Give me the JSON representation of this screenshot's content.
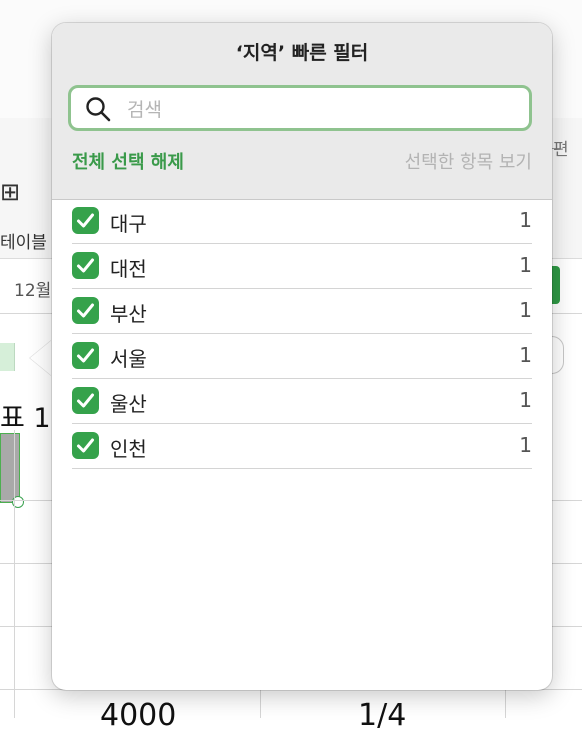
{
  "background": {
    "toolbar_label_left": "테이블",
    "size_label_left": "12월",
    "table_title": "표 1",
    "right_edge_text": "편",
    "cell_values": [
      "4000",
      "1/4"
    ]
  },
  "popover": {
    "title": "‘지역’ 빠른 필터",
    "search": {
      "placeholder": "검색",
      "value": ""
    },
    "deselect_all_label": "전체 선택 해제",
    "show_selected_label": "선택한 항목 보기",
    "items": [
      {
        "label": "대구",
        "count": "1",
        "checked": true
      },
      {
        "label": "대전",
        "count": "1",
        "checked": true
      },
      {
        "label": "부산",
        "count": "1",
        "checked": true
      },
      {
        "label": "서울",
        "count": "1",
        "checked": true
      },
      {
        "label": "울산",
        "count": "1",
        "checked": true
      },
      {
        "label": "인천",
        "count": "1",
        "checked": true
      }
    ],
    "accent_color": "#35a24b"
  }
}
